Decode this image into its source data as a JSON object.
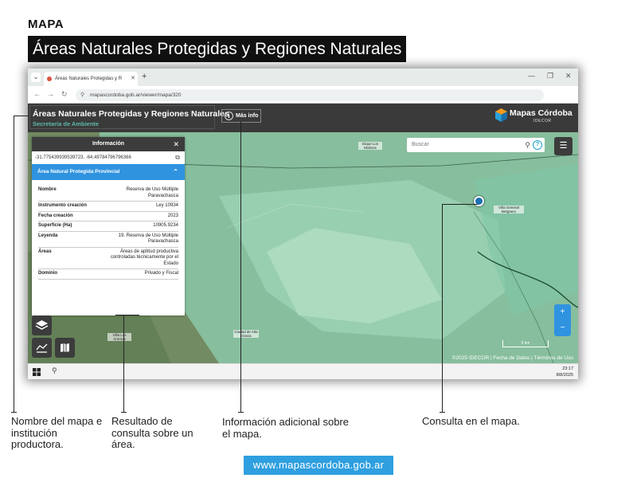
{
  "header": {
    "label": "MAPA",
    "title": "Áreas Naturales Protegidas y Regiones Naturales"
  },
  "browser": {
    "tab_title": "Áreas Naturales Protegidas y R",
    "url": "mapascordoba.gob.ar/viewer/mapa/320"
  },
  "app": {
    "title": "Áreas Naturales Protegidas y Regiones Naturales",
    "subtitle": "Secretaría de Ambiente",
    "more_info": "Más info",
    "logo_name": "Mapas Córdoba",
    "logo_sub": "IDECOR",
    "search_placeholder": "Buscar"
  },
  "info_panel": {
    "title": "Información",
    "coords": "-31.775439939539723, -64.49784796796366",
    "section": "Área Natural Protegida Provincial",
    "rows": [
      {
        "key": "Nombre",
        "value": "Reserva de Uso Múltiple Paravachasca"
      },
      {
        "key": "Instrumento creación",
        "value": "Ley 10934"
      },
      {
        "key": "Fecha creación",
        "value": "2023"
      },
      {
        "key": "Superficie (Ha)",
        "value": "10905.9234"
      },
      {
        "key": "Leyenda",
        "value": "19. Reserva de Uso Múltiple Paravachasca"
      },
      {
        "key": "Áreas",
        "value": "Áreas de aptitud productiva controladas técnicamente por el Estado"
      },
      {
        "key": "Dominio",
        "value": "Privado y Fiscal"
      }
    ]
  },
  "map": {
    "attribution": "©2025 IDECOR | Fecha de Datos | Términos de Uso",
    "scale": "5 km",
    "labels": [
      "Dique Los Molinos",
      "Villa General Belgrano",
      "Ciudad de Alta Gracia",
      "Villa Los Aromos"
    ]
  },
  "taskbar": {
    "time": "23:17",
    "date": "8/8/2025"
  },
  "captions": {
    "map_name": "Nombre del mapa e institución productora.",
    "query_result": "Resultado de consulta sobre un área.",
    "additional_info": "Información adicional sobre el mapa.",
    "map_query": "Consulta en el mapa."
  },
  "footer": {
    "url": "www.mapascordoba.gob.ar"
  },
  "colors": {
    "accent_blue": "#2f93e0",
    "teal": "#5db8a8",
    "dark": "#3a3a3a"
  }
}
